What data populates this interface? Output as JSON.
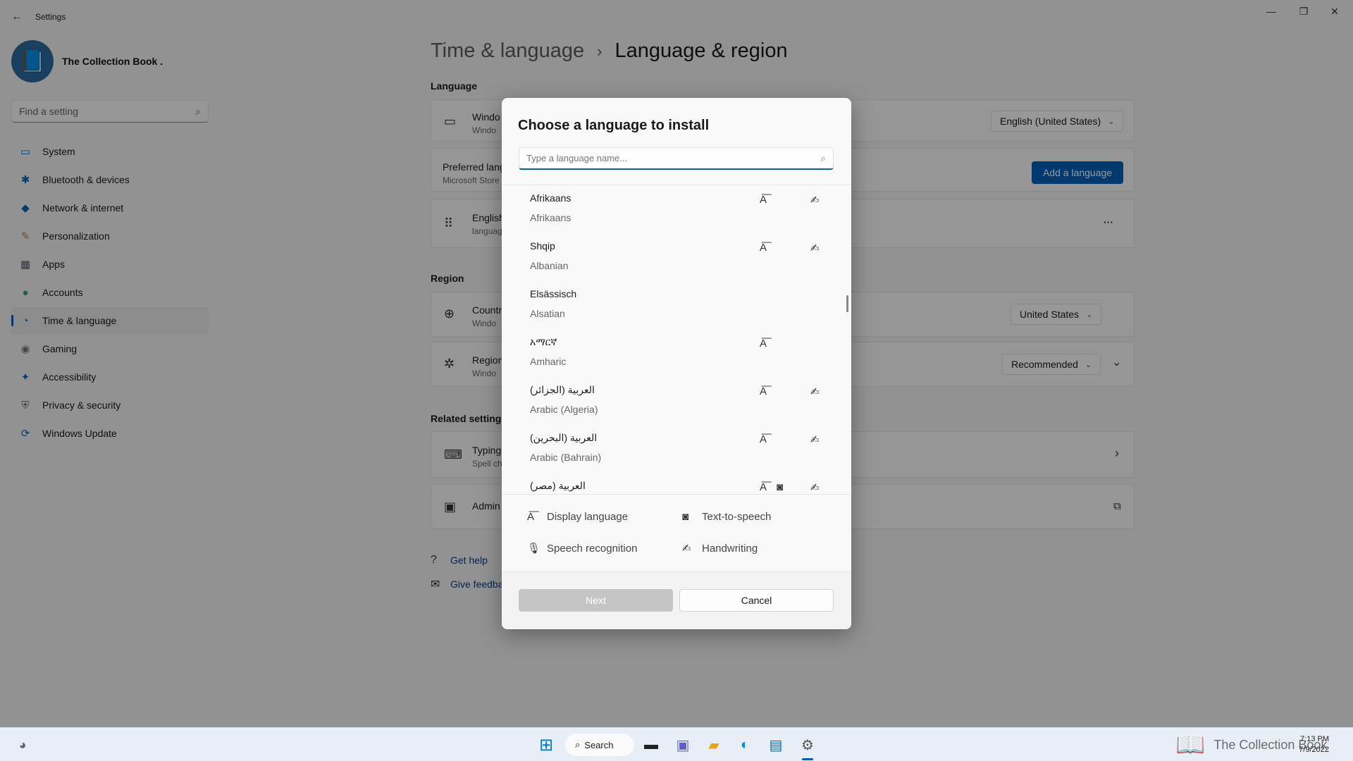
{
  "window": {
    "title": "Settings",
    "back_glyph": "←",
    "minimize_glyph": "—",
    "maximize_glyph": "❐",
    "close_glyph": "✕"
  },
  "profile": {
    "name": "The Collection Book .",
    "avatar_icon": "book-icon",
    "avatar_glyph": "📘"
  },
  "search": {
    "placeholder": "Find a setting",
    "icon_glyph": "⌕"
  },
  "nav": {
    "items": [
      {
        "label": "System",
        "icon": "system-icon",
        "glyph": "▭",
        "color": "#0078d4"
      },
      {
        "label": "Bluetooth & devices",
        "icon": "bluetooth-icon",
        "glyph": "✱",
        "color": "#0067c0"
      },
      {
        "label": "Network & internet",
        "icon": "wifi-icon",
        "glyph": "◆",
        "color": "#0067c0"
      },
      {
        "label": "Personalization",
        "icon": "brush-icon",
        "glyph": "✎",
        "color": "#c47a3c"
      },
      {
        "label": "Apps",
        "icon": "apps-icon",
        "glyph": "▦",
        "color": "#4a5a6e"
      },
      {
        "label": "Accounts",
        "icon": "person-icon",
        "glyph": "●",
        "color": "#2ea36b"
      },
      {
        "label": "Time & language",
        "icon": "clock-globe-icon",
        "glyph": "◔",
        "color": "#0067c0"
      },
      {
        "label": "Gaming",
        "icon": "gamepad-icon",
        "glyph": "◉",
        "color": "#6e7783"
      },
      {
        "label": "Accessibility",
        "icon": "accessibility-icon",
        "glyph": "✦",
        "color": "#0a66c2"
      },
      {
        "label": "Privacy & security",
        "icon": "shield-icon",
        "glyph": "⛨",
        "color": "#6e7783"
      },
      {
        "label": "Windows Update",
        "icon": "update-icon",
        "glyph": "⟳",
        "color": "#0067c0"
      }
    ],
    "active_index": 6
  },
  "breadcrumb": {
    "parent": "Time & language",
    "separator": "›",
    "current": "Language & region"
  },
  "language_section": {
    "heading": "Language",
    "display_card": {
      "title": "Windo",
      "subtitle": "Windo",
      "dropdown": "English (United States)",
      "icon_glyph": "▭"
    },
    "preferred_card": {
      "title": "Preferred lang",
      "subtitle": "Microsoft Store",
      "button": "Add a language"
    },
    "english_card": {
      "title": "English",
      "subtitle": "languag",
      "drag_glyph": "⠿",
      "more_glyph": "···"
    }
  },
  "region_section": {
    "heading": "Region",
    "country_card": {
      "title": "Countr",
      "subtitle": "Windo",
      "dropdown": "United States",
      "icon_glyph": "⊕"
    },
    "format_card": {
      "title": "Region",
      "subtitle": "Windo",
      "dropdown": "Recommended",
      "icon_glyph": "✲",
      "expand_glyph": "⌄"
    }
  },
  "related_section": {
    "heading": "Related settings",
    "typing_card": {
      "title": "Typing",
      "subtitle": "Spell ch",
      "icon_glyph": "⌨",
      "arrow_glyph": "›"
    },
    "admin_card": {
      "title": "Admin",
      "icon_glyph": "▣",
      "external_glyph": "⧉"
    }
  },
  "links": {
    "help": "Get help",
    "feedback": "Give feedba",
    "help_glyph": "?",
    "feedback_glyph": "✉"
  },
  "dialog": {
    "title": "Choose a language to install",
    "search_placeholder": "Type a language name...",
    "search_glyph": "⌕",
    "languages": [
      {
        "native": "Afrikaans",
        "english": "Afrikaans",
        "display": true,
        "tts": false,
        "handwriting": true
      },
      {
        "native": "Shqip",
        "english": "Albanian",
        "display": true,
        "tts": false,
        "handwriting": true
      },
      {
        "native": "Elsässisch",
        "english": "Alsatian",
        "display": false,
        "tts": false,
        "handwriting": false
      },
      {
        "native": "አማርኛ",
        "english": "Amharic",
        "display": true,
        "tts": false,
        "handwriting": false
      },
      {
        "native": "العربية (الجزائر)",
        "english": "Arabic (Algeria)",
        "display": true,
        "tts": false,
        "handwriting": true
      },
      {
        "native": "العربية (البحرين)",
        "english": "Arabic (Bahrain)",
        "display": true,
        "tts": false,
        "handwriting": true
      },
      {
        "native": "العربية (مصر)",
        "english": "",
        "display": true,
        "tts": true,
        "handwriting": true
      }
    ],
    "feature_glyphs": {
      "display": "A͞",
      "tts": "◙",
      "speech": "🎙",
      "handwriting": "✍"
    },
    "legend": {
      "display_language": "Display language",
      "text_to_speech": "Text-to-speech",
      "speech_recognition": "Speech recognition",
      "handwriting": "Handwriting"
    },
    "next_button": "Next",
    "cancel_button": "Cancel"
  },
  "taskbar": {
    "search_label": "Search",
    "search_glyph": "⌕",
    "time": "7:13 PM",
    "date": "7/9/2022",
    "watermark": "The Collection Book",
    "start_glyph": "⊞",
    "apps": [
      {
        "name": "file-explorer-icon",
        "glyph": "▬",
        "color": "#222"
      },
      {
        "name": "teams-chat-icon",
        "glyph": "▣",
        "color": "#5b5fc7"
      },
      {
        "name": "folder-icon",
        "glyph": "▰",
        "color": "#e8a317"
      },
      {
        "name": "edge-icon",
        "glyph": "◐",
        "color": "#0c8bd6"
      },
      {
        "name": "store-icon",
        "glyph": "▤",
        "color": "#0067c0"
      },
      {
        "name": "settings-gear-icon",
        "glyph": "⚙",
        "color": "#555"
      }
    ]
  }
}
